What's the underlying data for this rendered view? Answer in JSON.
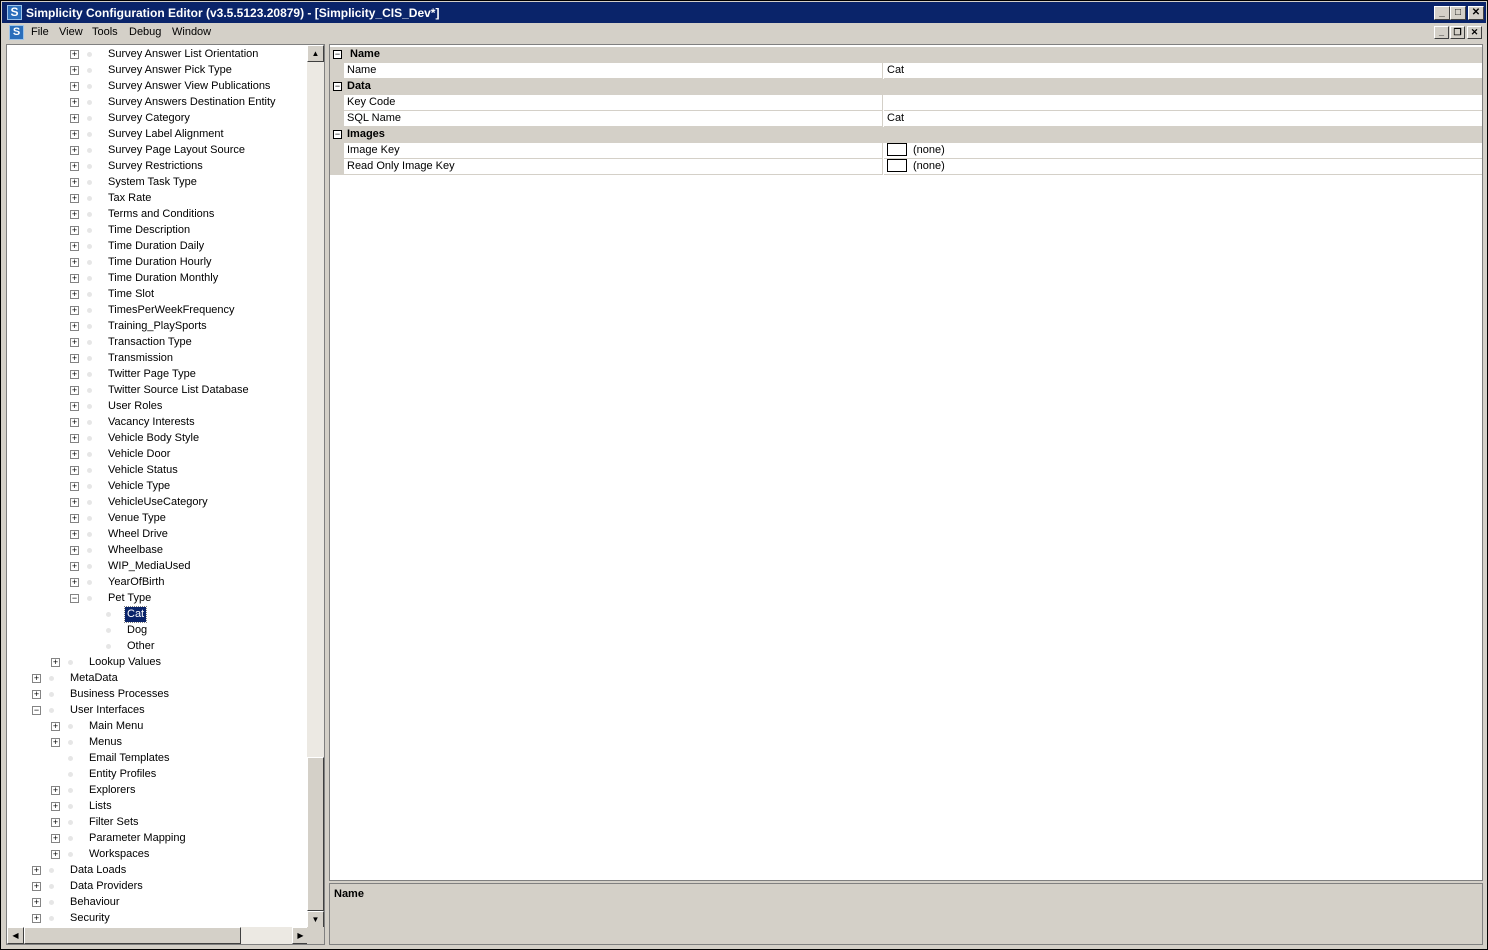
{
  "window": {
    "title": "Simplicity Configuration Editor (v3.5.5123.20879) - [Simplicity_CIS_Dev*]",
    "app_icon": "S",
    "caption_buttons": [
      "_",
      "□",
      "✕"
    ],
    "mdi_buttons": [
      "_",
      "❐",
      "✕"
    ]
  },
  "menu": {
    "items": [
      "File",
      "View",
      "Tools",
      "Debug",
      "Window"
    ]
  },
  "tree": {
    "rows": [
      {
        "label": "Survey Answer List Orientation",
        "level": 3,
        "toggle": "+"
      },
      {
        "label": "Survey Answer Pick Type",
        "level": 3,
        "toggle": "+"
      },
      {
        "label": "Survey Answer View Publications",
        "level": 3,
        "toggle": "+"
      },
      {
        "label": "Survey Answers Destination Entity",
        "level": 3,
        "toggle": "+"
      },
      {
        "label": "Survey Category",
        "level": 3,
        "toggle": "+"
      },
      {
        "label": "Survey Label Alignment",
        "level": 3,
        "toggle": "+"
      },
      {
        "label": "Survey Page Layout Source",
        "level": 3,
        "toggle": "+"
      },
      {
        "label": "Survey Restrictions",
        "level": 3,
        "toggle": "+"
      },
      {
        "label": "System Task Type",
        "level": 3,
        "toggle": "+"
      },
      {
        "label": "Tax Rate",
        "level": 3,
        "toggle": "+"
      },
      {
        "label": "Terms and Conditions",
        "level": 3,
        "toggle": "+"
      },
      {
        "label": "Time Description",
        "level": 3,
        "toggle": "+"
      },
      {
        "label": "Time Duration Daily",
        "level": 3,
        "toggle": "+"
      },
      {
        "label": "Time Duration Hourly",
        "level": 3,
        "toggle": "+"
      },
      {
        "label": "Time Duration Monthly",
        "level": 3,
        "toggle": "+"
      },
      {
        "label": "Time Slot",
        "level": 3,
        "toggle": "+"
      },
      {
        "label": "TimesPerWeekFrequency",
        "level": 3,
        "toggle": "+"
      },
      {
        "label": "Training_PlaySports",
        "level": 3,
        "toggle": "+"
      },
      {
        "label": "Transaction Type",
        "level": 3,
        "toggle": "+"
      },
      {
        "label": "Transmission",
        "level": 3,
        "toggle": "+"
      },
      {
        "label": "Twitter Page Type",
        "level": 3,
        "toggle": "+"
      },
      {
        "label": "Twitter Source List Database",
        "level": 3,
        "toggle": "+"
      },
      {
        "label": "User Roles",
        "level": 3,
        "toggle": "+"
      },
      {
        "label": "Vacancy Interests",
        "level": 3,
        "toggle": "+"
      },
      {
        "label": "Vehicle Body Style",
        "level": 3,
        "toggle": "+"
      },
      {
        "label": "Vehicle Door",
        "level": 3,
        "toggle": "+"
      },
      {
        "label": "Vehicle Status",
        "level": 3,
        "toggle": "+"
      },
      {
        "label": "Vehicle Type",
        "level": 3,
        "toggle": "+"
      },
      {
        "label": "VehicleUseCategory",
        "level": 3,
        "toggle": "+"
      },
      {
        "label": "Venue Type",
        "level": 3,
        "toggle": "+"
      },
      {
        "label": "Wheel Drive",
        "level": 3,
        "toggle": "+"
      },
      {
        "label": "Wheelbase",
        "level": 3,
        "toggle": "+"
      },
      {
        "label": "WIP_MediaUsed",
        "level": 3,
        "toggle": "+"
      },
      {
        "label": "YearOfBirth",
        "level": 3,
        "toggle": "+"
      },
      {
        "label": "Pet Type",
        "level": 3,
        "toggle": "−"
      },
      {
        "label": "Cat",
        "level": 4,
        "toggle": "",
        "selected": true
      },
      {
        "label": "Dog",
        "level": 4,
        "toggle": ""
      },
      {
        "label": "Other",
        "level": 4,
        "toggle": ""
      },
      {
        "label": "Lookup Values",
        "level": 2,
        "toggle": "+"
      },
      {
        "label": "MetaData",
        "level": 1,
        "toggle": "+"
      },
      {
        "label": "Business Processes",
        "level": 1,
        "toggle": "+"
      },
      {
        "label": "User Interfaces",
        "level": 1,
        "toggle": "−"
      },
      {
        "label": "Main Menu",
        "level": 2,
        "toggle": "+"
      },
      {
        "label": "Menus",
        "level": 2,
        "toggle": "+"
      },
      {
        "label": "Email Templates",
        "level": 2,
        "toggle": ""
      },
      {
        "label": "Entity Profiles",
        "level": 2,
        "toggle": ""
      },
      {
        "label": "Explorers",
        "level": 2,
        "toggle": "+"
      },
      {
        "label": "Lists",
        "level": 2,
        "toggle": "+"
      },
      {
        "label": "Filter Sets",
        "level": 2,
        "toggle": "+"
      },
      {
        "label": "Parameter Mapping",
        "level": 2,
        "toggle": "+"
      },
      {
        "label": "Workspaces",
        "level": 2,
        "toggle": "+"
      },
      {
        "label": "Data Loads",
        "level": 1,
        "toggle": "+"
      },
      {
        "label": "Data Providers",
        "level": 1,
        "toggle": "+"
      },
      {
        "label": "Behaviour",
        "level": 1,
        "toggle": "+"
      },
      {
        "label": "Security",
        "level": 1,
        "toggle": "+"
      }
    ]
  },
  "properties": {
    "categories": [
      {
        "title": "Name",
        "props": [
          {
            "name": "Name",
            "value": "Cat"
          }
        ]
      },
      {
        "title": "Data",
        "props": [
          {
            "name": "Key Code",
            "value": ""
          },
          {
            "name": "SQL Name",
            "value": "Cat"
          }
        ]
      },
      {
        "title": "Images",
        "props": [
          {
            "name": "Image Key",
            "value": "(none)",
            "swatch": true
          },
          {
            "name": "Read Only Image Key",
            "value": "(none)",
            "swatch": true
          }
        ]
      }
    ]
  },
  "description": {
    "title": "Name"
  },
  "colors": {
    "titlebar": "#0a246a",
    "selection": "#0a246a",
    "chrome": "#d4d0c8"
  }
}
